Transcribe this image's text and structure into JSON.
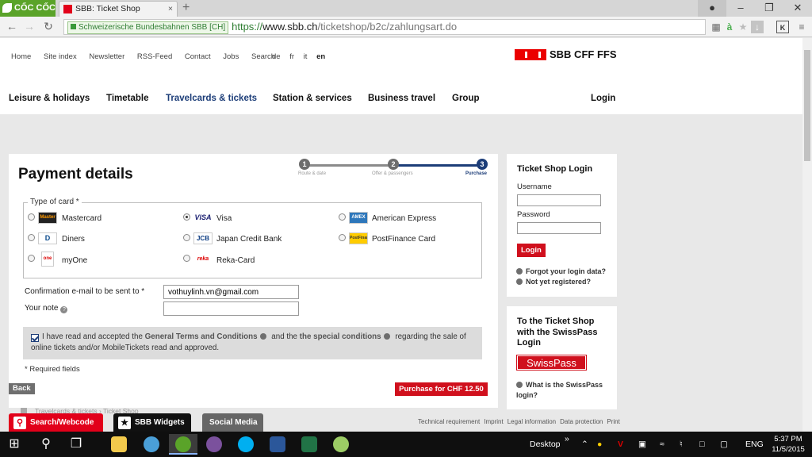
{
  "browser": {
    "brand": "CỐC CỐC",
    "tab_title": "SBB: Ticket Shop",
    "tab_close": "×",
    "new_tab": "+",
    "secure_label": "Schweizerische Bundesbahnen SBB [CH]",
    "url_scheme": "https://",
    "url_host": "www.sbb.ch",
    "url_path": "/ticketshop/b2c/zahlungsart.do",
    "ext_kaspersky": "K"
  },
  "header": {
    "util_links": [
      "Home",
      "Site index",
      "Newsletter",
      "RSS-Feed",
      "Contact",
      "Jobs",
      "Search"
    ],
    "languages": [
      "de",
      "fr",
      "it",
      "en"
    ],
    "active_language": "en",
    "logo_text": "SBB CFF FFS",
    "main_nav": [
      "Leisure & holidays",
      "Timetable",
      "Travelcards & tickets",
      "Station & services",
      "Business travel",
      "Group"
    ],
    "login": "Login"
  },
  "payment": {
    "title": "Payment details",
    "steps": [
      {
        "num": "1",
        "label": "Route & date"
      },
      {
        "num": "2",
        "label": "Offer & passengers"
      },
      {
        "num": "3",
        "label": "Purchase"
      }
    ],
    "card_legend": "Type of card *",
    "cards": [
      {
        "label": "Mastercard",
        "icon": "Master",
        "selected": false
      },
      {
        "label": "Visa",
        "icon": "VISA",
        "selected": true
      },
      {
        "label": "American Express",
        "icon": "AMEX",
        "selected": false
      },
      {
        "label": "Diners",
        "icon": "D",
        "selected": false
      },
      {
        "label": "Japan Credit Bank",
        "icon": "JCB",
        "selected": false
      },
      {
        "label": "PostFinance Card",
        "icon": "PostFinance",
        "selected": false
      },
      {
        "label": "myOne",
        "icon": "one",
        "selected": false
      },
      {
        "label": "Reka-Card",
        "icon": "reka",
        "selected": false
      }
    ],
    "email_label": "Confirmation e-mail to be sent to *",
    "email_value": "vothuylinh.vn@gmail.com",
    "note_label": "Your note",
    "note_value": "",
    "terms_checked": true,
    "terms_1": "I have read and accepted the",
    "terms_link1": "General Terms and Conditions",
    "terms_2": "and the",
    "terms_link2": "the special conditions",
    "terms_3": "regarding the sale of online tickets and/or MobileTickets read and approved.",
    "required_note": "* Required fields",
    "back": "Back",
    "purchase": "Purchase for CHF 12.50",
    "breadcrumb_1": "Travelcards & tickets",
    "breadcrumb_2": "Ticket Shop"
  },
  "login_box": {
    "title": "Ticket Shop Login",
    "username_label": "Username",
    "password_label": "Password",
    "button": "Login",
    "forgot": "Forgot your login data?",
    "not_registered": "Not yet registered?"
  },
  "swisspass_box": {
    "title": "To the Ticket Shop with the SwissPass Login",
    "brand": "SwissPass",
    "link": "What is the SwissPass login?"
  },
  "footer": {
    "links": [
      "Technical requirement",
      "Imprint",
      "Legal information",
      "Data protection",
      "Print"
    ],
    "tab_search": "Search/Webcode",
    "tab_widgets": "SBB Widgets",
    "tab_social": "Social Media"
  },
  "taskbar": {
    "desktop": "Desktop",
    "chevron": "»",
    "lang": "ENG",
    "time": "5:37 PM",
    "date": "11/5/2015"
  },
  "colors": {
    "sbb_red": "#eb0000",
    "button_red": "#d0101d",
    "nav_blue": "#1c3d78"
  }
}
